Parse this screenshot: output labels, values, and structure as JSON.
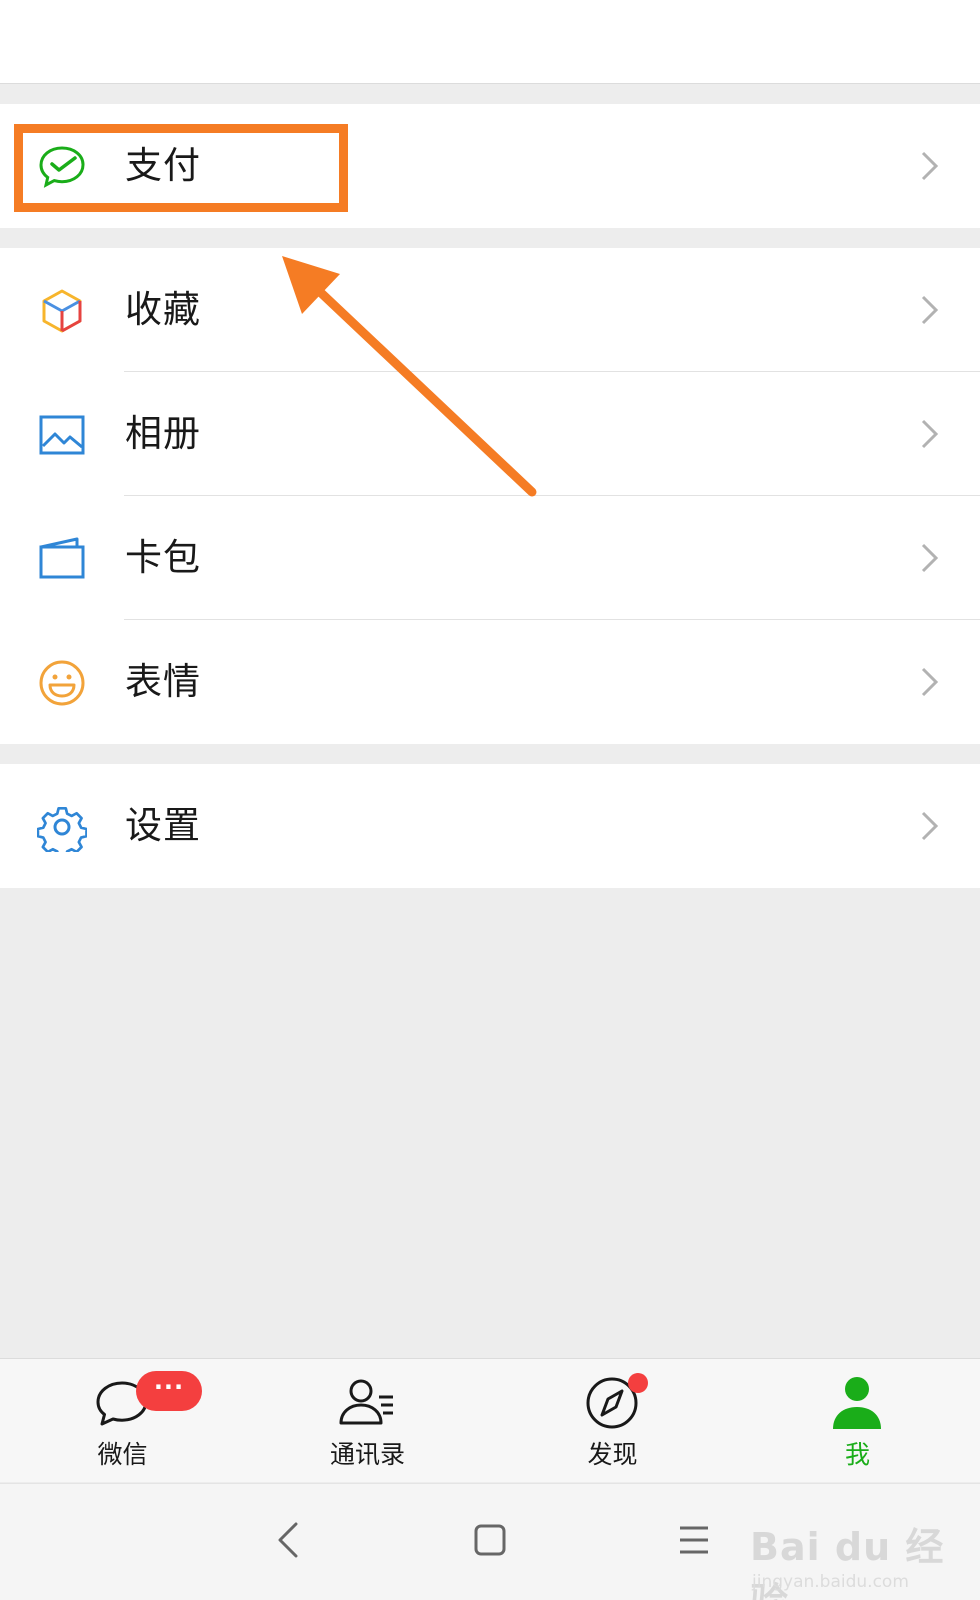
{
  "menu": {
    "pay": {
      "label": "支付",
      "icon": "wechat-pay-icon"
    },
    "favorites": {
      "label": "收藏",
      "icon": "favorites-cube-icon"
    },
    "album": {
      "label": "相册",
      "icon": "album-picture-icon"
    },
    "cards": {
      "label": "卡包",
      "icon": "card-wallet-icon"
    },
    "stickers": {
      "label": "表情",
      "icon": "sticker-smile-icon"
    },
    "settings": {
      "label": "设置",
      "icon": "settings-gear-icon"
    }
  },
  "annotation": {
    "color": "#f57c24"
  },
  "tabbar": {
    "tabs": [
      {
        "label": "微信",
        "icon": "chats-bubble-icon",
        "badge": "···"
      },
      {
        "label": "通讯录",
        "icon": "contacts-icon"
      },
      {
        "label": "发现",
        "icon": "discover-compass-icon"
      },
      {
        "label": "我",
        "icon": "me-person-icon"
      }
    ],
    "active_color": "#1aad19",
    "badge_color": "#f43f3f"
  },
  "navbar": {
    "buttons": [
      "back-icon",
      "home-icon",
      "menu-icon"
    ]
  },
  "watermark": {
    "brand": "Bai du 经验",
    "url": "jingyan.baidu.com"
  }
}
